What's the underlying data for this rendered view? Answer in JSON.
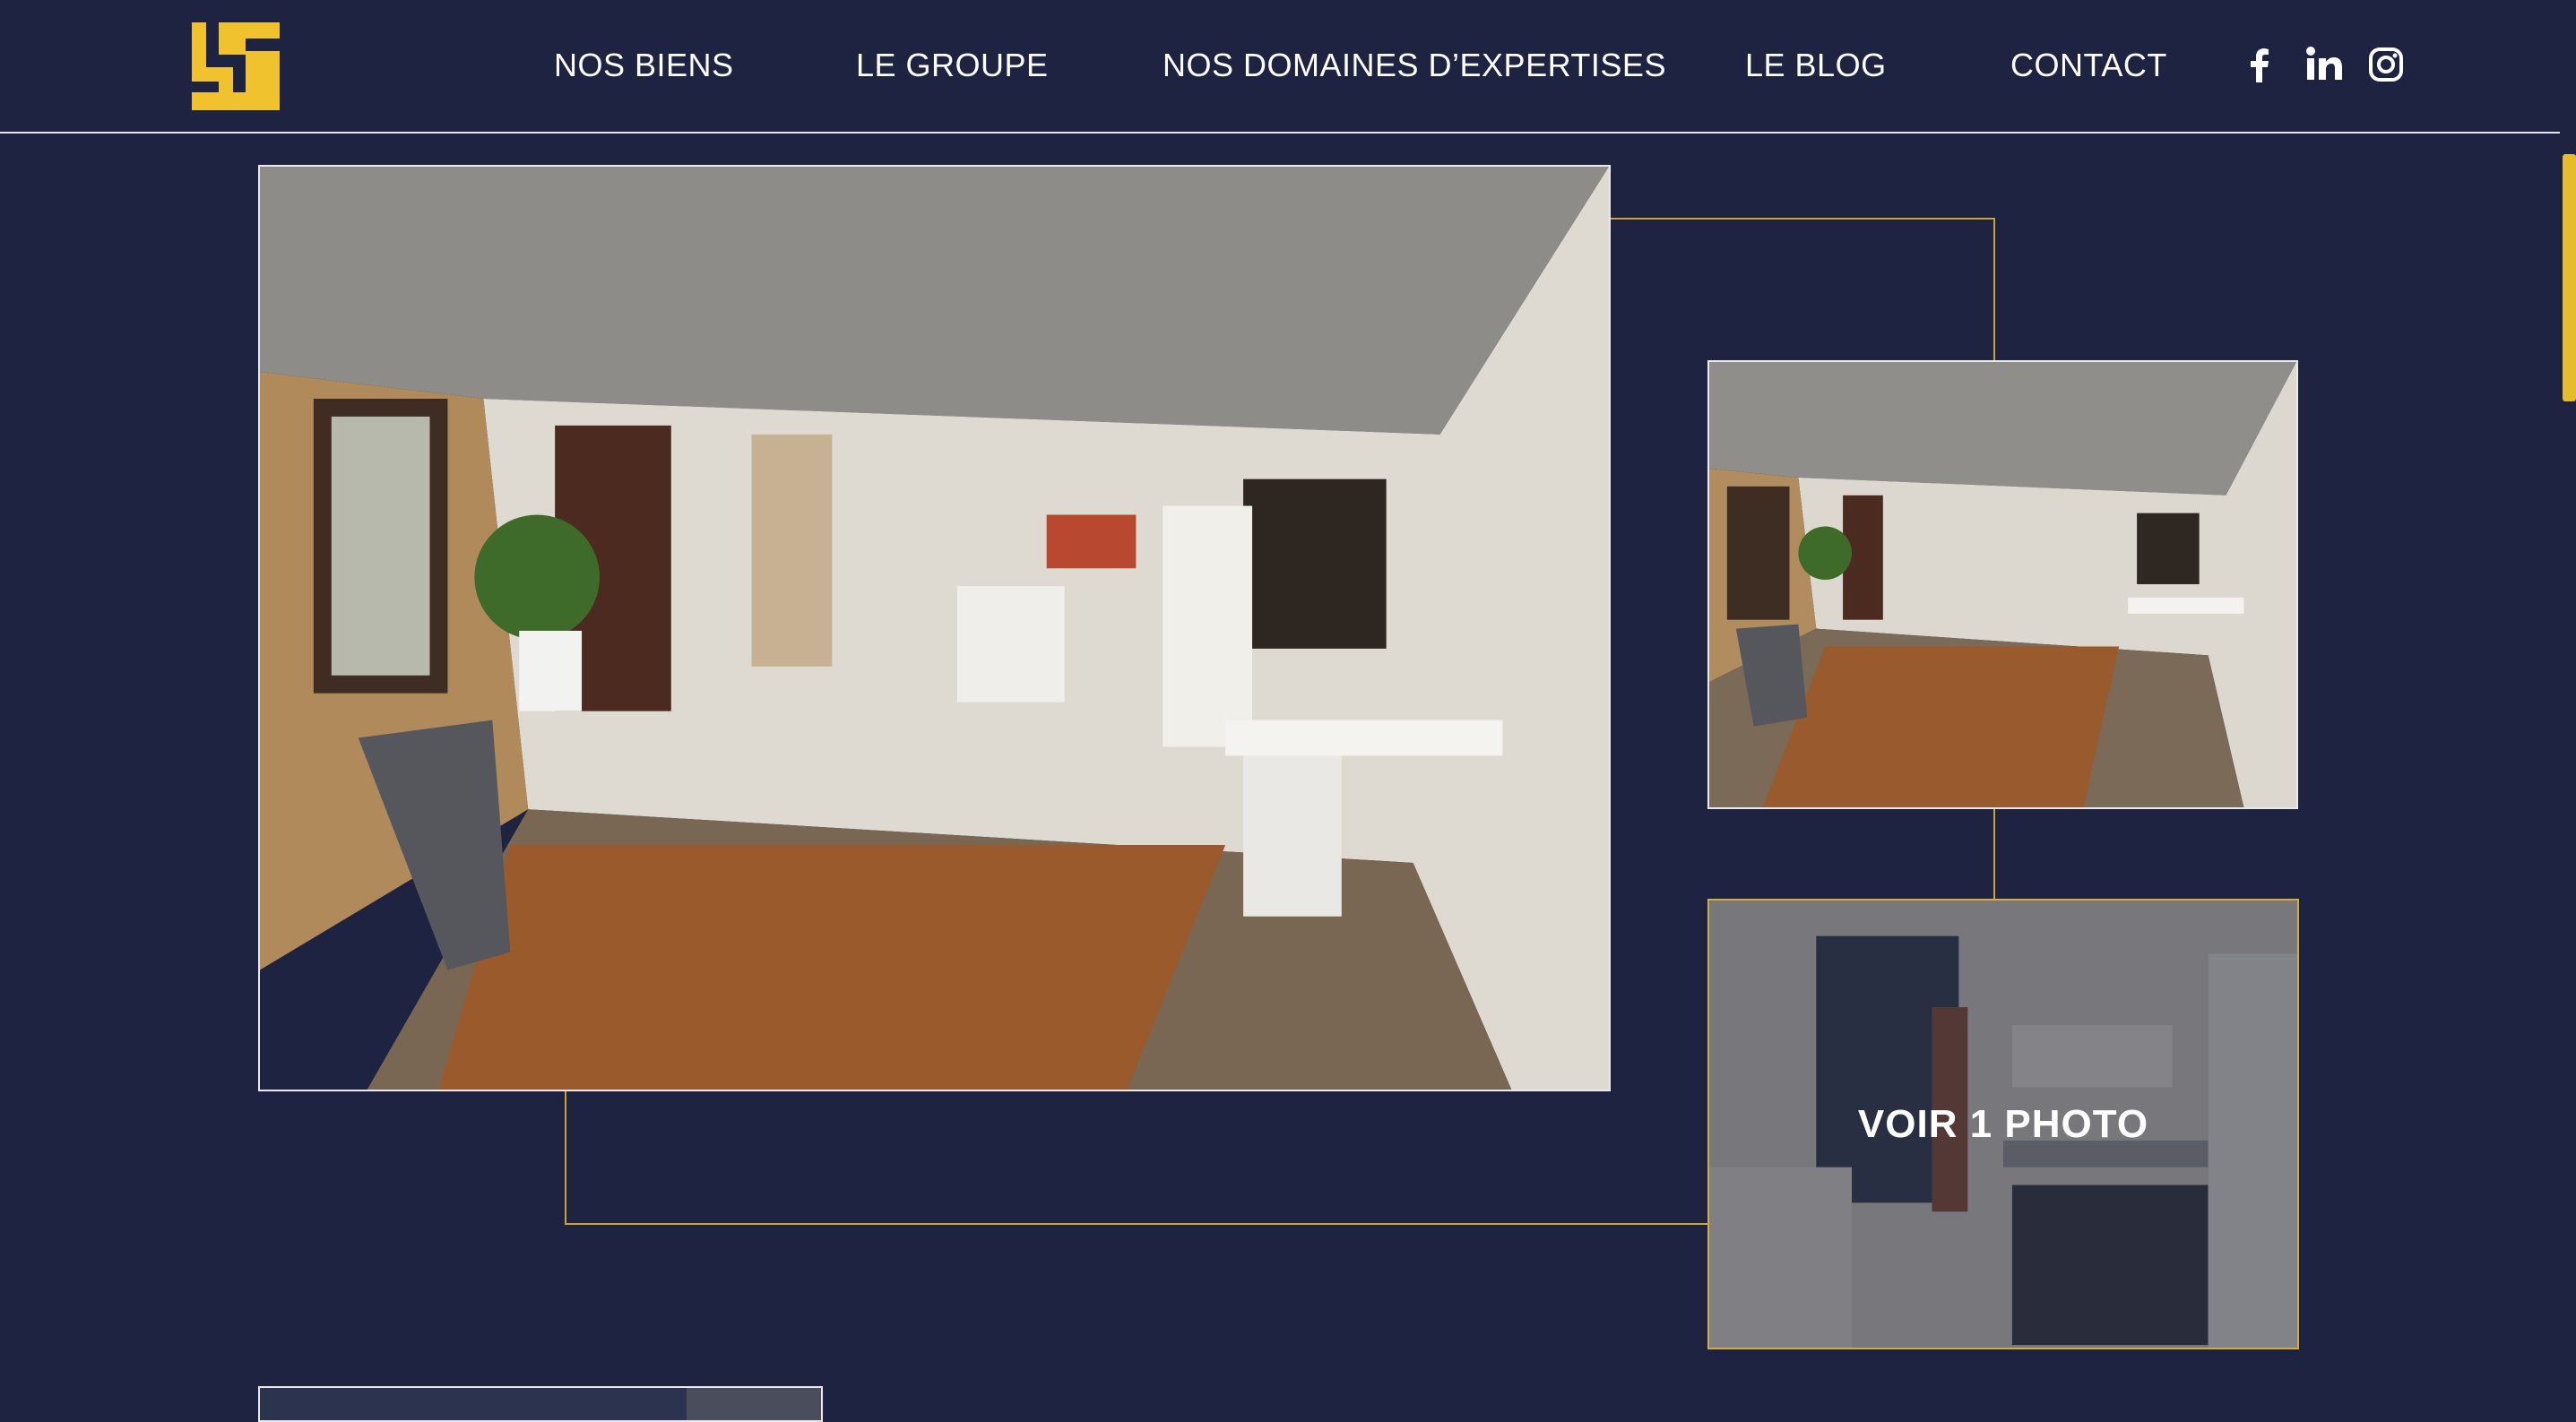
{
  "brand": {
    "logo_icon": "lt-monogram-logo",
    "accent": "#f0c22e",
    "background": "#1d2341"
  },
  "nav": {
    "items": [
      {
        "label": "NOS BIENS"
      },
      {
        "label": "LE GROUPE"
      },
      {
        "label": "NOS DOMAINES D’EXPERTISES"
      },
      {
        "label": "LE BLOG"
      },
      {
        "label": "CONTACT"
      }
    ],
    "social": [
      "facebook-icon",
      "linkedin-icon",
      "instagram-icon"
    ]
  },
  "gallery": {
    "photos": [
      "office-interior-photo-main",
      "office-interior-photo-side",
      "kitchen-photo"
    ],
    "more_label": "VOIR 1 PHOTO"
  }
}
